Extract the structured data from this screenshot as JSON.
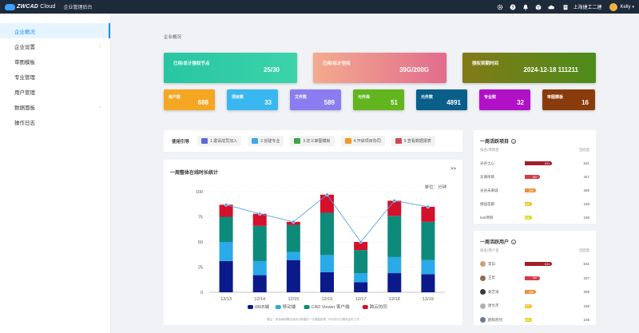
{
  "header": {
    "logo_main": "ZWCAD",
    "logo_sub": "Cloud",
    "app_title": "企业管理后台",
    "company": "上海捷工二建",
    "username": "Kelly",
    "icons": [
      "gear-icon",
      "help-icon",
      "bell-icon",
      "box-icon",
      "cloud-icon",
      "building-icon"
    ]
  },
  "sidebar": {
    "items": [
      {
        "label": "企业概况",
        "active": true,
        "expandable": false
      },
      {
        "label": "企业设置",
        "active": false,
        "expandable": true
      },
      {
        "label": "审图模板",
        "active": false,
        "expandable": false
      },
      {
        "label": "专业管理",
        "active": false,
        "expandable": false
      },
      {
        "label": "用户管理",
        "active": false,
        "expandable": false
      },
      {
        "label": "数据面板",
        "active": false,
        "expandable": true
      },
      {
        "label": "操作日志",
        "active": false,
        "expandable": false
      }
    ]
  },
  "breadcrumb": "企业概况",
  "summary_cards": [
    {
      "label": "已用/总计授权节点",
      "value": "25/30",
      "color_from": "#2ec7a9",
      "color_to": "#36d1a8"
    },
    {
      "label": "已用/总计空间",
      "value": "39G/200G",
      "color_from": "#f0a78d",
      "color_to": "#e36e8d"
    },
    {
      "label": "授权到期时间",
      "value": "2024-12-18 111211",
      "color_from": "#7b7a1a",
      "color_to": "#4c8b1c"
    }
  ],
  "stat_cards": [
    {
      "label": "用户数",
      "value": "688",
      "color": "#f5a622"
    },
    {
      "label": "项目数",
      "value": "33",
      "color": "#39b7f0"
    },
    {
      "label": "文件数",
      "value": "589",
      "color": "#8c7cf2"
    },
    {
      "label": "元件库",
      "value": "51",
      "color": "#62b51e"
    },
    {
      "label": "元件数",
      "value": "4891",
      "color": "#0a5f8a"
    },
    {
      "label": "专业数",
      "value": "32",
      "color": "#b011c7"
    },
    {
      "label": "审图模板",
      "value": "16",
      "color": "#8a3b0c"
    }
  ],
  "guide": {
    "title": "使用引导",
    "steps": [
      {
        "label": "1.邀请成员加入",
        "icon": "invite-icon",
        "color": "#5b6ad0"
      },
      {
        "label": "2.创建专业",
        "icon": "folder-icon",
        "color": "#3aa7e8"
      },
      {
        "label": "3.定义审图模板",
        "icon": "template-icon",
        "color": "#3fa34d"
      },
      {
        "label": "4.开启项目协同",
        "icon": "collab-icon",
        "color": "#f09a2a"
      },
      {
        "label": "5.查看数据报表",
        "icon": "report-icon",
        "color": "#d0484f"
      }
    ]
  },
  "online_chart_panel": {
    "title": "一周整体在线时长统计",
    "more": ">>",
    "unit": "单位：分钟",
    "note": "备注：系统每周期自动统计数据的一次调整处理，时长统计日期临近时工作"
  },
  "chart_data": {
    "type": "bar",
    "stacked": true,
    "categories": [
      "12/13",
      "12/14",
      "12/15",
      "12/16",
      "12/17",
      "12/18",
      "12/19"
    ],
    "ylim": [
      0,
      100
    ],
    "yticks": [
      0,
      25,
      50,
      75,
      100
    ],
    "series": [
      {
        "name": "WEB端",
        "color": "#0b1a8a",
        "values": [
          31,
          17,
          32,
          20,
          10,
          19,
          18
        ]
      },
      {
        "name": "移动端",
        "color": "#2aaae8",
        "values": [
          19,
          14,
          8,
          17,
          9,
          16,
          14
        ]
      },
      {
        "name": "CAD Viewer 客户端",
        "color": "#0e8a7a",
        "values": [
          25,
          35,
          27,
          42,
          23,
          41,
          38
        ]
      },
      {
        "name": "跨云协同",
        "color": "#d4102a",
        "values": [
          12,
          12,
          3,
          18,
          8,
          15,
          15
        ]
      }
    ],
    "line_series": {
      "color": "#5aa0e8",
      "values": [
        87,
        78,
        70,
        97,
        50,
        91,
        85
      ]
    },
    "grid": true,
    "legend_position": "bottom"
  },
  "active_projects": {
    "title": "一周活跃项目",
    "head_left": "排名/项目名",
    "head_right": "活跃度",
    "rows": [
      {
        "name": "光谷之心",
        "value": 631,
        "bar_label": "631",
        "color": "#a31e2a"
      },
      {
        "name": "东湖项目",
        "value": 347,
        "bar_label": "347",
        "color": "#d63a4a"
      },
      {
        "name": "光谷未来城",
        "value": 259,
        "bar_label": "259",
        "color": "#e8923a"
      },
      {
        "name": "保园花都",
        "value": 159,
        "bar_label": "159",
        "color": "#f2c12e"
      },
      {
        "name": "test项目",
        "value": 159,
        "bar_label": "159",
        "color": "#e0d52a"
      }
    ]
  },
  "active_users": {
    "title": "一周活跃用户",
    "head_left": "排名/用户名",
    "head_right": "活跃度",
    "rows": [
      {
        "name": "李白",
        "value": 631,
        "bar_label": "631",
        "color": "#a31e2a",
        "avatar": "#c9a27a"
      },
      {
        "name": "王炅",
        "value": 347,
        "bar_label": "347",
        "color": "#d63a4a",
        "avatar": "#8a6b5a"
      },
      {
        "name": "姜艺涛",
        "value": 259,
        "bar_label": "259",
        "color": "#e8923a",
        "avatar": "#3a3a3a"
      },
      {
        "name": "唐文杰",
        "value": 159,
        "bar_label": "159",
        "color": "#f2c12e",
        "avatar": "#b0b0b0"
      },
      {
        "name": "欧阳热烈",
        "value": 159,
        "bar_label": "159",
        "color": "#e0d52a",
        "avatar": "#6c7a8a"
      }
    ]
  }
}
